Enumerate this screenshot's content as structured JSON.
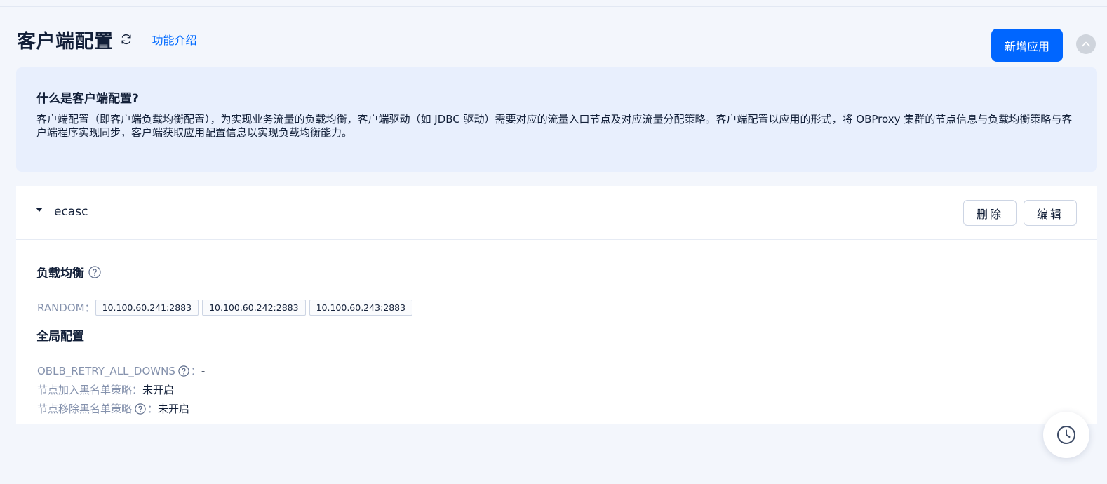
{
  "header": {
    "title": "客户端配置",
    "intro_link": "功能介绍",
    "add_button": "新增应用"
  },
  "info": {
    "title": "什么是客户端配置?",
    "text": "客户端配置（即客户端负载均衡配置），为实现业务流量的负载均衡，客户端驱动（如 JDBC 驱动）需要对应的流量入口节点及对应流量分配策略。客户端配置以应用的形式，将 OBProxy 集群的节点信息与负载均衡策略与客户端程序实现同步，客户端获取应用配置信息以实现负载均衡能力。"
  },
  "app": {
    "name": "ecasc",
    "delete_label": "删除",
    "edit_label": "编辑",
    "lb_title": "负载均衡",
    "lb_strategy": "RANDOM：",
    "nodes": [
      "10.100.60.241:2883",
      "10.100.60.242:2883",
      "10.100.60.243:2883"
    ],
    "global_title": "全局配置",
    "configs": [
      {
        "label": "OBLB_RETRY_ALL_DOWNS",
        "suffix": "：",
        "value": "-"
      },
      {
        "label": "节点加入黑名单策略：",
        "value": "未开启"
      },
      {
        "label": "节点移除黑名单策略",
        "suffix": "：",
        "value": "未开启"
      }
    ]
  },
  "colors": {
    "primary": "#0066ff",
    "background": "#f3f6fc",
    "info_bg": "#e8effd",
    "text": "#132039",
    "muted": "#8592ad"
  },
  "icons": [
    "refresh-icon",
    "chevron-up-icon",
    "caret-down-icon",
    "help-icon",
    "clock-icon"
  ]
}
